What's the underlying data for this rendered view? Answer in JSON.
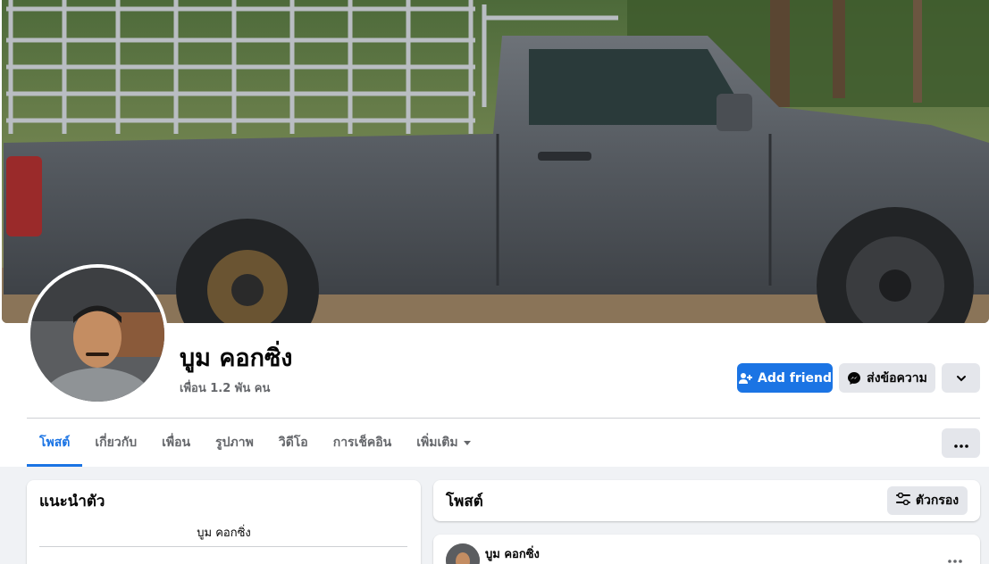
{
  "profile": {
    "name": "บูม คอกซิ่ง",
    "friends_count": "เพื่อน 1.2 พัน คน"
  },
  "actions": {
    "add_friend": "Add friend",
    "message": "ส่งข้อความ"
  },
  "tabs": [
    {
      "label": "โพสต์",
      "active": true
    },
    {
      "label": "เกี่ยวกับ"
    },
    {
      "label": "เพื่อน"
    },
    {
      "label": "รูปภาพ"
    },
    {
      "label": "วิดีโอ"
    },
    {
      "label": "การเช็คอิน"
    },
    {
      "label": "เพิ่มเติม"
    }
  ],
  "intro": {
    "title": "แนะนำตัว",
    "bio": "บูม คอกซิ่ง"
  },
  "posts": {
    "title": "โพสต์",
    "filter_label": "ตัวกรอง",
    "first_author": "บูม คอกซิ่ง"
  },
  "colors": {
    "accent": "#1b74e4",
    "button_gray": "#e4e6eb",
    "page_bg": "#f0f2f5"
  }
}
